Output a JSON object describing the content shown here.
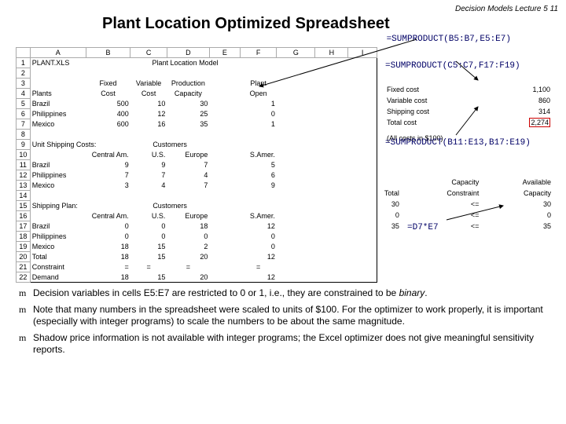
{
  "header": {
    "page_num_line": "Decision Models  Lecture 5  11",
    "title": "Plant Location Optimized Spreadsheet"
  },
  "formulas": {
    "top": "=SUMPRODUCT(B5:B7,E5:E7)",
    "right1": "=SUMPRODUCT(C5:C7,F17:F19)",
    "right2": "=SUMPRODUCT(B11:E13,B17:E19)",
    "right3": "=D7*E7"
  },
  "cols": [
    "A",
    "B",
    "C",
    "D",
    "E",
    "F",
    "G",
    "H",
    "I"
  ],
  "sheet": {
    "filename": "PLANT.XLS",
    "model_title": "Plant Location Model",
    "hdr4": {
      "fixed": "Fixed",
      "variable": "Variable",
      "production": "Production",
      "plant": "Plant"
    },
    "hdr5": {
      "plants": "Plants",
      "cost": "Cost",
      "cost2": "Cost",
      "capacity": "Capacity",
      "open": "Open"
    },
    "plants": [
      {
        "name": "Brazil",
        "fixed": "500",
        "var": "10",
        "cap": "30",
        "open": "1"
      },
      {
        "name": "Philippines",
        "fixed": "400",
        "var": "12",
        "cap": "25",
        "open": "0"
      },
      {
        "name": "Mexico",
        "fixed": "600",
        "var": "16",
        "cap": "35",
        "open": "1"
      }
    ],
    "unitship_label": "Unit Shipping Costs:",
    "customers_label": "Customers",
    "regions": {
      "cam": "Central Am.",
      "us": "U.S.",
      "eur": "Europe",
      "sam": "S.Amer."
    },
    "shipcost": [
      {
        "name": "Brazil",
        "cam": "9",
        "us": "9",
        "eur": "7",
        "sam": "5"
      },
      {
        "name": "Philippines",
        "cam": "7",
        "us": "7",
        "eur": "4",
        "sam": "6"
      },
      {
        "name": "Mexico",
        "cam": "3",
        "us": "4",
        "eur": "7",
        "sam": "9"
      }
    ],
    "shippingplan_label": "Shipping Plan:",
    "plan": [
      {
        "name": "Brazil",
        "cam": "0",
        "us": "0",
        "eur": "18",
        "sam": "12",
        "total": "30"
      },
      {
        "name": "Philippines",
        "cam": "0",
        "us": "0",
        "eur": "0",
        "sam": "0",
        "total": "0"
      },
      {
        "name": "Mexico",
        "cam": "18",
        "us": "15",
        "eur": "2",
        "sam": "0",
        "total": "35"
      }
    ],
    "totals": {
      "label": "Total",
      "cam": "18",
      "us": "15",
      "eur": "20",
      "sam": "12"
    },
    "constraint": {
      "label": "Constraint",
      "cam": "=",
      "us": "=",
      "eur": "=",
      "sam": "="
    },
    "demand": {
      "label": "Demand",
      "cam": "18",
      "us": "15",
      "eur": "20",
      "sam": "12"
    },
    "side": {
      "fixed_label": "Fixed cost",
      "fixed_val": "1,100",
      "var_label": "Variable cost",
      "var_val": "860",
      "ship_label": "Shipping cost",
      "ship_val": "314",
      "total_label": "Total cost",
      "total_val": "2,274",
      "allcosts": "(All costs in $100)"
    },
    "cap": {
      "hdr_total": "Total",
      "hdr_capacity": "Capacity",
      "hdr_constraint": "Constraint",
      "hdr_available": "Available",
      "rows": [
        {
          "total": "30",
          "con": "<=",
          "avail": "30"
        },
        {
          "total": "0",
          "con": "<=",
          "avail": "0"
        },
        {
          "total": "35",
          "con": "<=",
          "avail": "35"
        }
      ]
    }
  },
  "notes": {
    "n1a": "Decision variables in cells E5:E7 are restricted to 0 or 1, i.e., they are constrained to be ",
    "n1b": "binary",
    "n1c": ".",
    "n2": "Note that many numbers in the spreadsheet were scaled to units of $100.  For the optimizer to work properly, it is important (especially with integer programs) to scale the numbers to be about the same magnitude.",
    "n3": "Shadow price information is not available with integer programs; the Excel optimizer does not give meaningful sensitivity reports."
  }
}
